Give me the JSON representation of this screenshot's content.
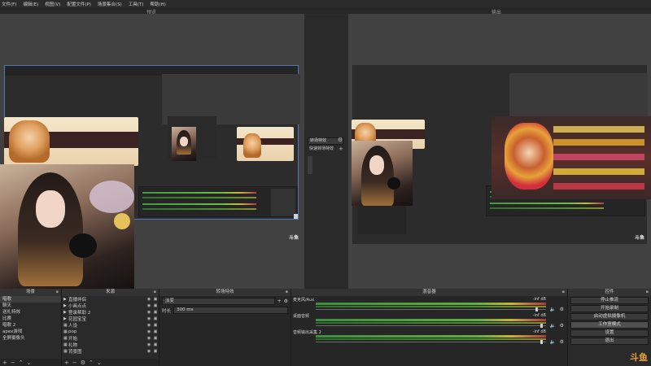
{
  "menu": [
    "文件(F)",
    "编辑(E)",
    "视图(V)",
    "配置文件(P)",
    "场景集合(S)",
    "工具(T)",
    "帮助(H)"
  ],
  "panes": {
    "preview_title": "预览",
    "program_title": "输出"
  },
  "transition_center": {
    "button1": "转场特效",
    "button2": "快速转场特效"
  },
  "scenes": {
    "title": "场景",
    "items": [
      "唱歌",
      "聊天",
      "送礼特效",
      "比赛",
      "唱歌 2",
      "apex游戏",
      "全屏摄像头"
    ],
    "selected_index": 0
  },
  "sources": {
    "title": "来源",
    "items": [
      "直播伴侣",
      "小画点点",
      "登录帮助 2",
      "花园宝宝",
      "人设",
      "pop",
      "开始",
      "礼物",
      "背景图"
    ]
  },
  "transitions": {
    "title": "转场特效",
    "type_value": "淡变",
    "duration_label": "时长",
    "duration_value": "300 ms"
  },
  "mixer": {
    "title": "混音器",
    "channels": [
      {
        "name": "麦克风/Aux",
        "db": "-inf dB"
      },
      {
        "name": "桌面音频",
        "db": "-inf dB"
      },
      {
        "name": "音频输出采集 2",
        "db": "-inf dB"
      }
    ]
  },
  "controls": {
    "title": "控件",
    "buttons": [
      "停止推流",
      "开始录制",
      "启动虚拟摄像机",
      "工作室模式",
      "设置",
      "退出"
    ],
    "active_index": 3
  },
  "watermark": "斗鱼",
  "colors": {
    "accent": "#e8a23a",
    "meter_green": "#5fb03f",
    "panel": "#2a2a2a"
  }
}
